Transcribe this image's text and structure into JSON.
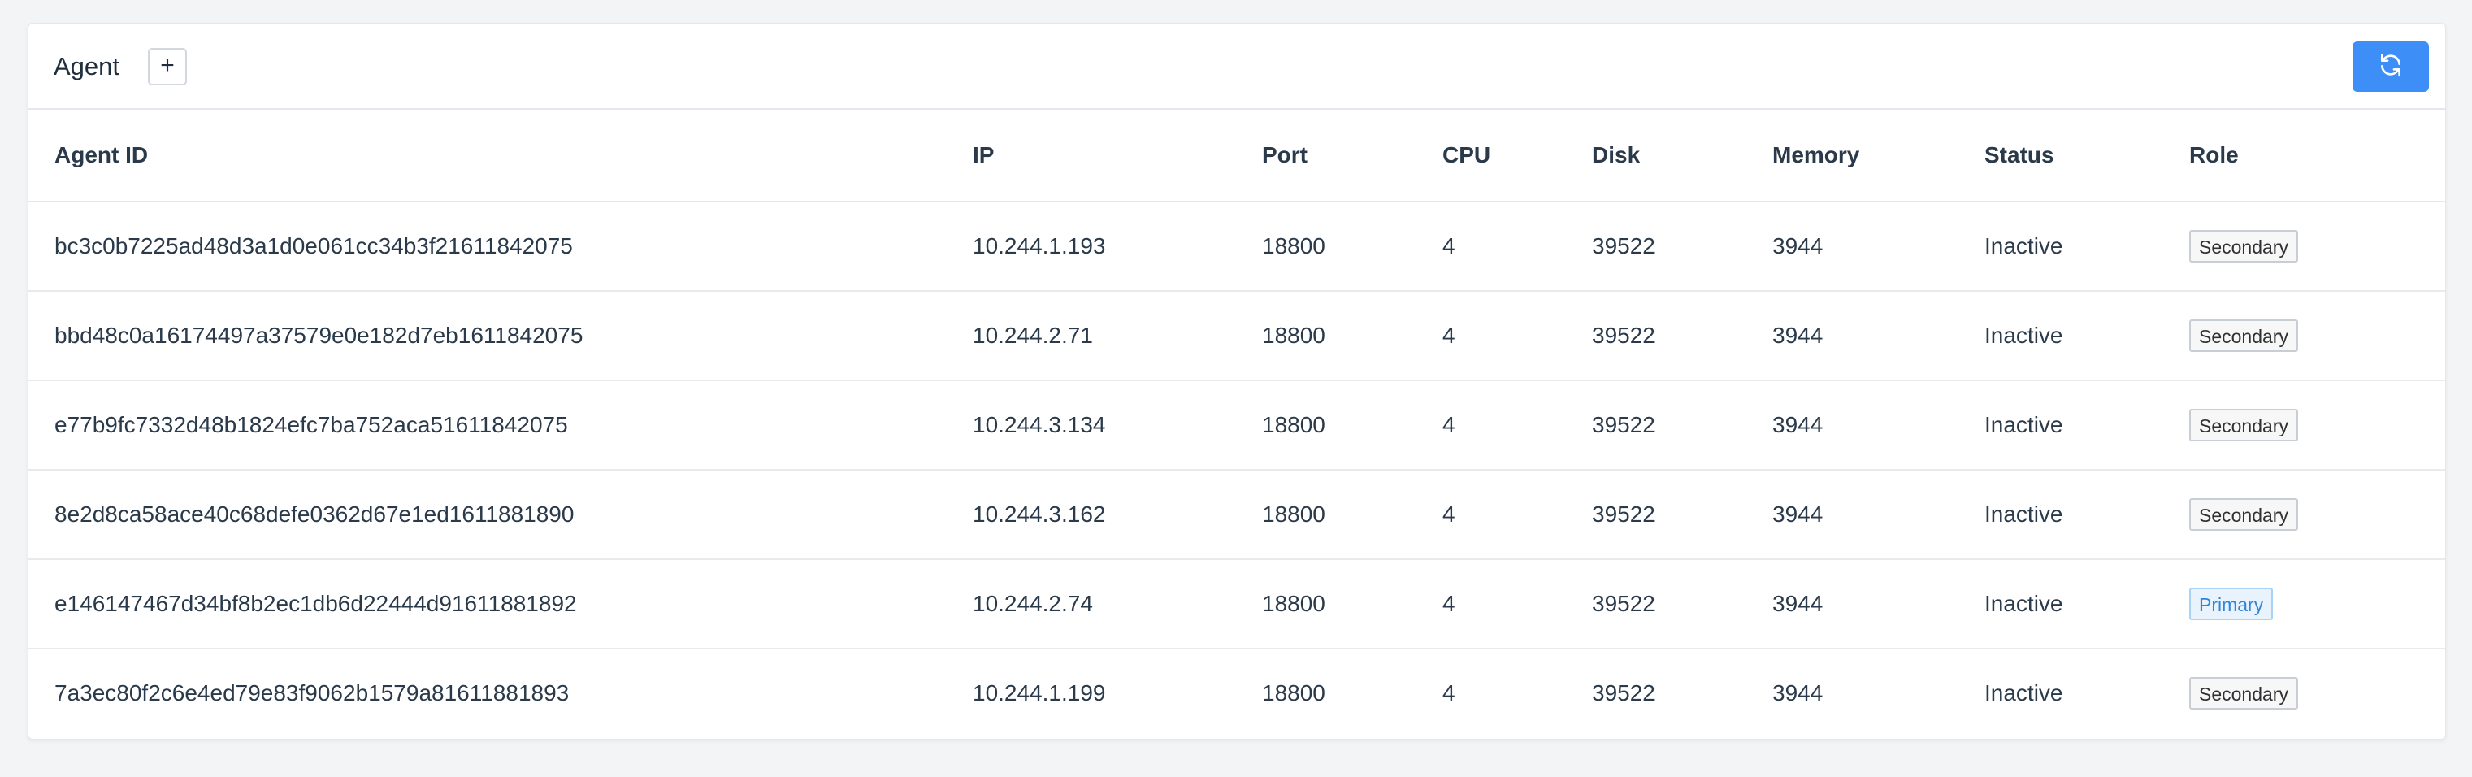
{
  "header": {
    "title": "Agent",
    "add_label": "+"
  },
  "columns": [
    "Agent ID",
    "IP",
    "Port",
    "CPU",
    "Disk",
    "Memory",
    "Status",
    "Role"
  ],
  "rows": [
    {
      "agent_id": "bc3c0b7225ad48d3a1d0e061cc34b3f21611842075",
      "ip": "10.244.1.193",
      "port": "18800",
      "cpu": "4",
      "disk": "39522",
      "memory": "3944",
      "status": "Inactive",
      "role": "Secondary",
      "role_type": "secondary"
    },
    {
      "agent_id": "bbd48c0a16174497a37579e0e182d7eb1611842075",
      "ip": "10.244.2.71",
      "port": "18800",
      "cpu": "4",
      "disk": "39522",
      "memory": "3944",
      "status": "Inactive",
      "role": "Secondary",
      "role_type": "secondary"
    },
    {
      "agent_id": "e77b9fc7332d48b1824efc7ba752aca51611842075",
      "ip": "10.244.3.134",
      "port": "18800",
      "cpu": "4",
      "disk": "39522",
      "memory": "3944",
      "status": "Inactive",
      "role": "Secondary",
      "role_type": "secondary"
    },
    {
      "agent_id": "8e2d8ca58ace40c68defe0362d67e1ed1611881890",
      "ip": "10.244.3.162",
      "port": "18800",
      "cpu": "4",
      "disk": "39522",
      "memory": "3944",
      "status": "Inactive",
      "role": "Secondary",
      "role_type": "secondary"
    },
    {
      "agent_id": "e146147467d34bf8b2ec1db6d22444d91611881892",
      "ip": "10.244.2.74",
      "port": "18800",
      "cpu": "4",
      "disk": "39522",
      "memory": "3944",
      "status": "Inactive",
      "role": "Primary",
      "role_type": "primary"
    },
    {
      "agent_id": "7a3ec80f2c6e4ed79e83f9062b1579a81611881893",
      "ip": "10.244.1.199",
      "port": "18800",
      "cpu": "4",
      "disk": "39522",
      "memory": "3944",
      "status": "Inactive",
      "role": "Secondary",
      "role_type": "secondary"
    }
  ],
  "icons": {
    "refresh": "refresh-icon"
  },
  "colors": {
    "accent": "#3d8ef7",
    "primary_tag": "#2f86d8",
    "page_bg": "#f3f4f6"
  }
}
